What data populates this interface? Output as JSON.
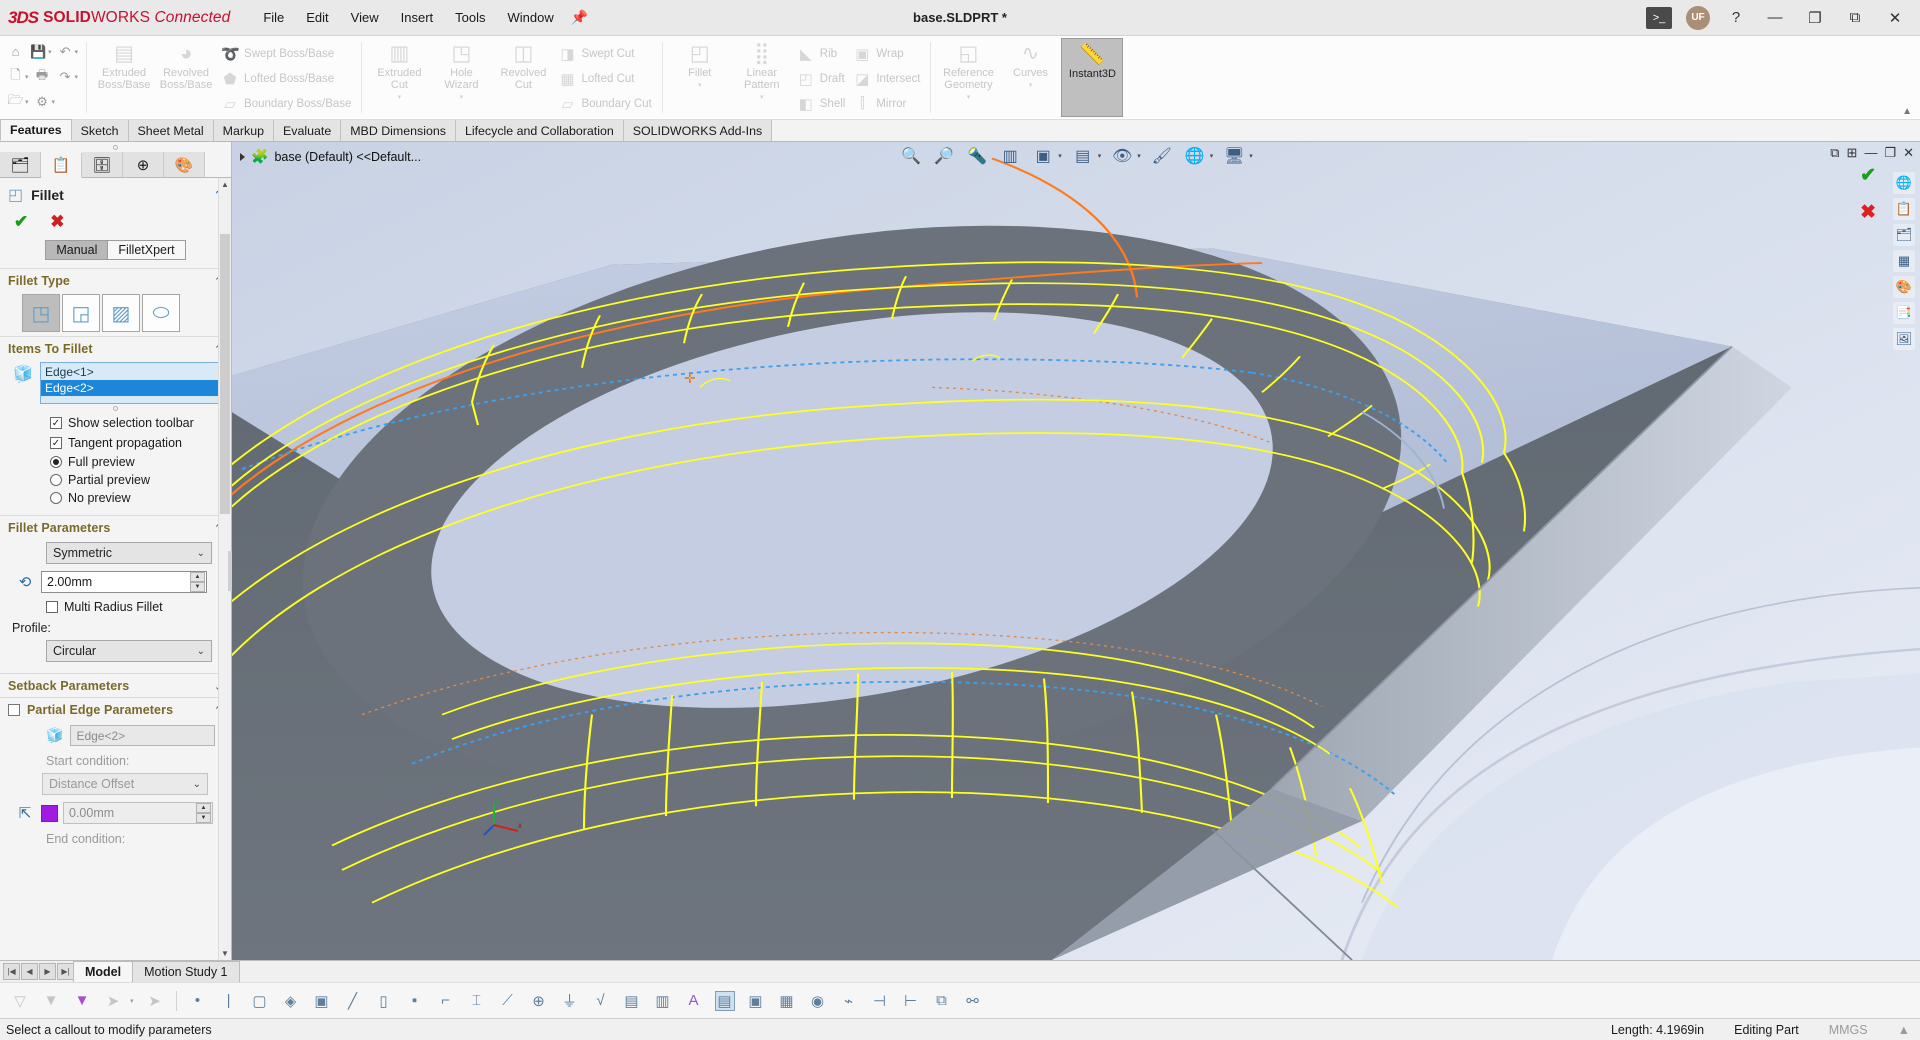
{
  "titlebar": {
    "brand_bold": "SOLID",
    "brand_thin": "WORKS",
    "brand_conn": "Connected",
    "document_title": "base.SLDPRT *",
    "menus": [
      "File",
      "Edit",
      "View",
      "Insert",
      "Tools",
      "Window"
    ],
    "pin_icon": "pin-icon",
    "terminal_icon": "terminal-icon",
    "avatar_initials": "UF",
    "help_icon": "help-icon",
    "minimize": "—",
    "restore": "⧉",
    "maximize": "❐",
    "close": "✕"
  },
  "quick_access": {
    "icons": [
      "home-icon",
      "save-icon",
      "undo-icon",
      "new-doc-icon",
      "print-icon",
      "redo-icon",
      "open-icon",
      "options-gear-icon"
    ]
  },
  "ribbon": {
    "groups": [
      {
        "name": "features-primary",
        "big": [
          {
            "label": "Extruded\nBoss/Base",
            "icon": "extruded-boss-icon",
            "dropdown": false
          },
          {
            "label": "Revolved\nBoss/Base",
            "icon": "revolved-boss-icon",
            "dropdown": false
          }
        ],
        "small": [
          {
            "label": "Swept Boss/Base",
            "icon": "swept-boss-icon"
          },
          {
            "label": "Lofted Boss/Base",
            "icon": "lofted-boss-icon"
          },
          {
            "label": "Boundary Boss/Base",
            "icon": "boundary-boss-icon"
          }
        ]
      },
      {
        "name": "cut-features",
        "big": [
          {
            "label": "Extruded\nCut",
            "icon": "extruded-cut-icon",
            "dropdown": true
          },
          {
            "label": "Hole\nWizard",
            "icon": "hole-wizard-icon",
            "dropdown": true
          },
          {
            "label": "Revolved\nCut",
            "icon": "revolved-cut-icon",
            "dropdown": false
          }
        ],
        "small": [
          {
            "label": "Swept Cut",
            "icon": "swept-cut-icon"
          },
          {
            "label": "Lofted Cut",
            "icon": "lofted-cut-icon"
          },
          {
            "label": "Boundary Cut",
            "icon": "boundary-cut-icon"
          }
        ]
      },
      {
        "name": "modify-features",
        "big": [
          {
            "label": "Fillet",
            "icon": "fillet-icon",
            "dropdown": true
          },
          {
            "label": "Linear\nPattern",
            "icon": "linear-pattern-icon",
            "dropdown": true
          }
        ],
        "small": [
          {
            "label": "Rib",
            "icon": "rib-icon"
          },
          {
            "label": "Draft",
            "icon": "draft-icon"
          },
          {
            "label": "Shell",
            "icon": "shell-icon"
          }
        ],
        "small2": [
          {
            "label": "Wrap",
            "icon": "wrap-icon"
          },
          {
            "label": "Intersect",
            "icon": "intersect-icon"
          },
          {
            "label": "Mirror",
            "icon": "mirror-icon"
          }
        ]
      },
      {
        "name": "reference",
        "big": [
          {
            "label": "Reference\nGeometry",
            "icon": "reference-geometry-icon",
            "dropdown": true
          },
          {
            "label": "Curves",
            "icon": "curves-icon",
            "dropdown": true
          },
          {
            "label": "Instant3D",
            "icon": "instant3d-icon",
            "dropdown": false,
            "active": true
          }
        ]
      }
    ]
  },
  "command_tabs": [
    {
      "label": "Features",
      "active": true
    },
    {
      "label": "Sketch",
      "active": false
    },
    {
      "label": "Sheet Metal",
      "active": false
    },
    {
      "label": "Markup",
      "active": false
    },
    {
      "label": "Evaluate",
      "active": false
    },
    {
      "label": "MBD Dimensions",
      "active": false
    },
    {
      "label": "Lifecycle and Collaboration",
      "active": false
    },
    {
      "label": "SOLIDWORKS Add-Ins",
      "active": false
    }
  ],
  "property_manager": {
    "tabs": [
      {
        "name": "feature-manager-tab",
        "icon": "feature-tree-icon",
        "active": false
      },
      {
        "name": "property-manager-tab",
        "icon": "property-list-icon",
        "active": true
      },
      {
        "name": "configuration-manager-tab",
        "icon": "configuration-icon",
        "active": false
      },
      {
        "name": "dimxpert-tab",
        "icon": "dimxpert-icon",
        "active": false
      },
      {
        "name": "display-manager-tab",
        "icon": "display-palette-icon",
        "active": false
      }
    ],
    "title": "Fillet",
    "ok_label": "✔",
    "cancel_label": "✖",
    "help_label": "?",
    "mode_manual": "Manual",
    "mode_filletxpert": "FilletXpert",
    "sections": {
      "fillet_type": {
        "title": "Fillet Type",
        "options": [
          {
            "name": "constant-size-fillet",
            "selected": true
          },
          {
            "name": "variable-size-fillet",
            "selected": false
          },
          {
            "name": "face-fillet",
            "selected": false
          },
          {
            "name": "full-round-fillet",
            "selected": false
          }
        ]
      },
      "items_to_fillet": {
        "title": "Items To Fillet",
        "selection": [
          {
            "label": "Edge<1>",
            "selected": false
          },
          {
            "label": "Edge<2>",
            "selected": true
          }
        ],
        "show_selection_toolbar": {
          "label": "Show selection toolbar",
          "checked": true
        },
        "tangent_propagation": {
          "label": "Tangent propagation",
          "checked": true
        },
        "preview_options": [
          {
            "label": "Full preview",
            "selected": true
          },
          {
            "label": "Partial preview",
            "selected": false
          },
          {
            "label": "No preview",
            "selected": false
          }
        ]
      },
      "fillet_parameters": {
        "title": "Fillet Parameters",
        "symmetry": "Symmetric",
        "radius": "2.00mm",
        "multi_radius": {
          "label": "Multi Radius Fillet",
          "checked": false
        },
        "profile_label": "Profile:",
        "profile": "Circular"
      },
      "setback_parameters": {
        "title": "Setback Parameters"
      },
      "partial_edge_parameters": {
        "title": "Partial Edge Parameters",
        "checked": false,
        "edge": "Edge<2>",
        "start_condition_label": "Start condition:",
        "start_condition": "Distance Offset",
        "start_value": "0.00mm",
        "end_condition_label": "End condition:"
      }
    }
  },
  "graphics": {
    "tree_root": "base (Default) <<Default...",
    "view_toolbar": [
      "zoom-to-fit-icon",
      "zoom-to-area-icon",
      "previous-view-icon",
      "section-view-icon",
      "view-orientation-icon",
      "display-style-icon",
      "hide-show-icon",
      "edit-appearance-icon",
      "apply-scene-icon",
      "view-settings-icon"
    ],
    "right_icons": [
      "view-palette-icon",
      "appearances-icon",
      "scenes-icon",
      "decals-icon",
      "custom-properties-icon",
      "design-library-icon",
      "file-explorer-icon"
    ],
    "window_buttons": [
      "restore-down-icon",
      "tile-icon",
      "minimize-icon",
      "maximize-icon",
      "close-icon"
    ],
    "confirm_ok": "✔",
    "confirm_cancel": "✖",
    "triad_axes": [
      "x",
      "y",
      "z"
    ]
  },
  "bottom": {
    "tabs": [
      {
        "label": "Model",
        "active": true
      },
      {
        "label": "Motion Study 1",
        "active": false
      }
    ],
    "nav_buttons": [
      "first-icon",
      "prev-icon",
      "next-icon",
      "last-icon"
    ],
    "sketch_icons": [
      "filter-icon",
      "clear-filter-icon",
      "filter-active-icon",
      "select-icon",
      "select-dropdown-icon",
      "no-select-icon",
      "point-icon",
      "line-icon",
      "face-icon",
      "surface-icon",
      "solid-icon",
      "axis-icon",
      "plane-icon",
      "vertex-icon",
      "sketch-entity-icon",
      "dimension-icon",
      "sketch-line-icon",
      "coordinate-system-icon",
      "annotation-icon",
      "weld-bead-icon",
      "callout-icon",
      "bom-icon",
      "midpoint-icon",
      "center-mark-icon",
      "datum-icon",
      "hole-callout-icon"
    ]
  },
  "statusbar": {
    "message": "Select a callout to modify parameters",
    "length": "Length: 4.1969in",
    "mode": "Editing Part",
    "units": "MMGS",
    "expand": "▲"
  },
  "colors": {
    "brand_red": "#c8102e",
    "selection_blue": "#1d86d8",
    "selection_list_bg": "#d9eaf7",
    "section_title": "#7a6a2a",
    "preview_yellow": "#ffff1a",
    "highlight_orange": "#ff7a1a",
    "edge_blue_dotted": "#3aa0f0",
    "graphics_bg": "#5d6670",
    "accent_purple": "#a21ae0"
  }
}
